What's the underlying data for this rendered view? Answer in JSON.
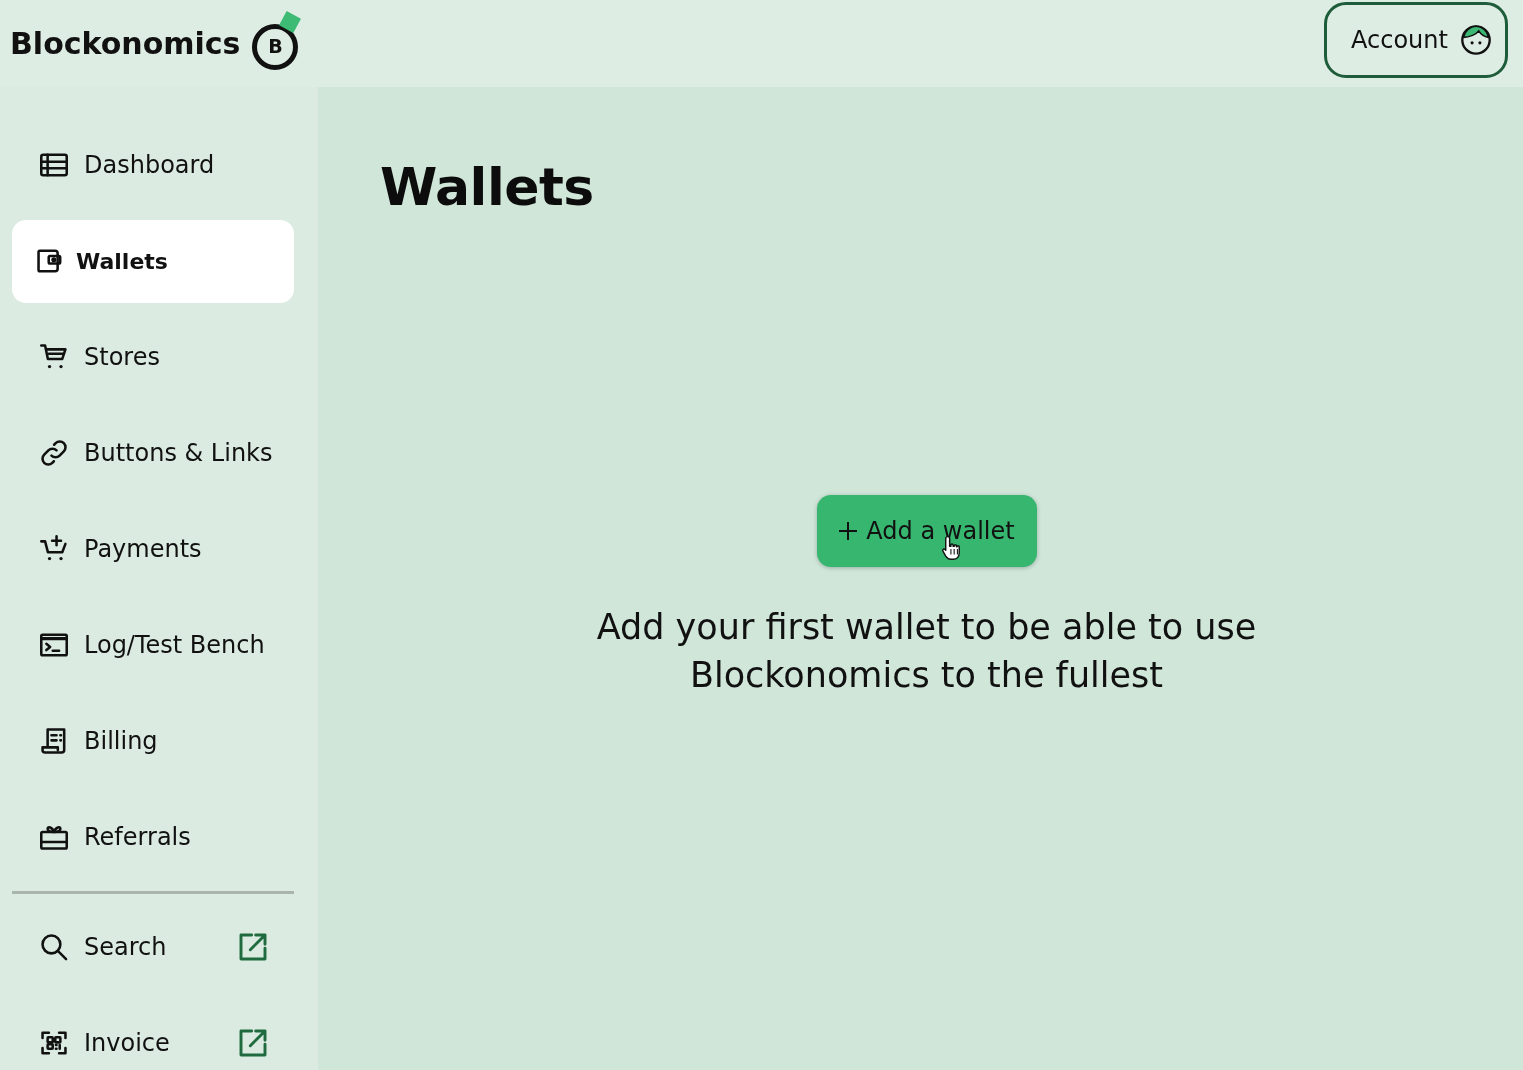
{
  "header": {
    "logo": {
      "text": "Blockonomics",
      "mark_letter": "B"
    },
    "account_button": {
      "label": "Account"
    }
  },
  "sidebar": {
    "nav_items": [
      {
        "label": "Dashboard",
        "selected": false
      },
      {
        "label": "Wallets",
        "selected": true
      },
      {
        "label": "Stores",
        "selected": false
      },
      {
        "label": "Buttons & Links",
        "selected": false
      },
      {
        "label": "Payments",
        "selected": false
      },
      {
        "label": "Log/Test Bench",
        "selected": false
      },
      {
        "label": "Billing",
        "selected": false
      },
      {
        "label": "Referrals",
        "selected": false
      }
    ],
    "tool_items": [
      {
        "label": "Search",
        "external": true
      },
      {
        "label": "Invoice",
        "external": true
      }
    ]
  },
  "main": {
    "title": "Wallets",
    "add_button": {
      "label": "Add a wallet",
      "hovered": true
    },
    "message": "Add your first wallet to be able to use Blockonomics to the fullest"
  }
}
